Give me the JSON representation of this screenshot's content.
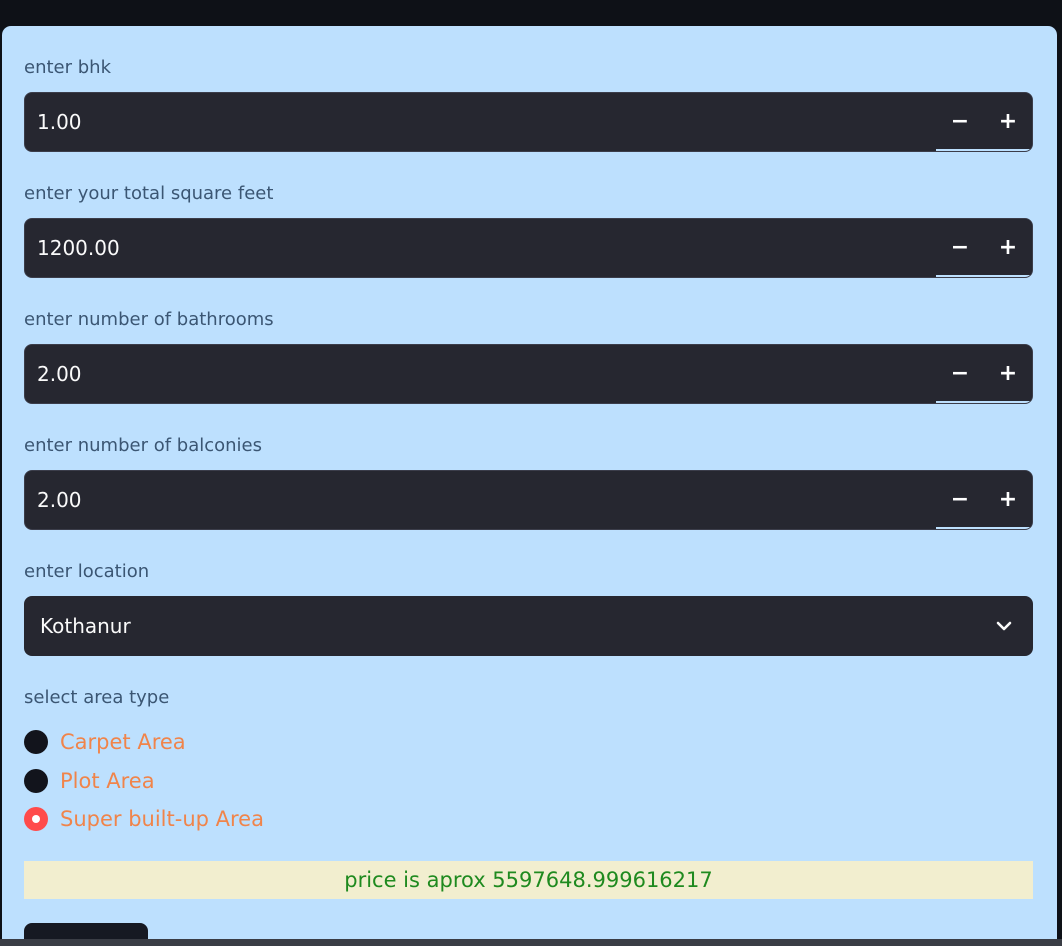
{
  "form": {
    "bhk": {
      "label": "enter bhk",
      "value": "1.00"
    },
    "sqft": {
      "label": "enter your total square feet",
      "value": "1200.00"
    },
    "bath": {
      "label": "enter number of bathrooms",
      "value": "2.00"
    },
    "balcony": {
      "label": "enter number of balconies",
      "value": "2.00"
    },
    "stepper": {
      "minus": "−",
      "plus": "+"
    },
    "location": {
      "label": "enter location",
      "value": "Kothanur"
    },
    "area_type": {
      "label": "select area type",
      "options": [
        "Carpet Area",
        "Plot Area",
        "Super built-up Area"
      ],
      "selected": "Super built-up Area"
    }
  },
  "result": {
    "text": "price is aprox 5597648.999616217"
  },
  "colors": {
    "panel": "#bde0fe",
    "input_bg": "#262730",
    "radio_accent": "#ff4b4b",
    "option_text": "#f0844a",
    "result_text": "#1f8a1f",
    "result_bg": "#f2eecf"
  },
  "icons": {
    "dropdown": "chevron-down-icon"
  }
}
